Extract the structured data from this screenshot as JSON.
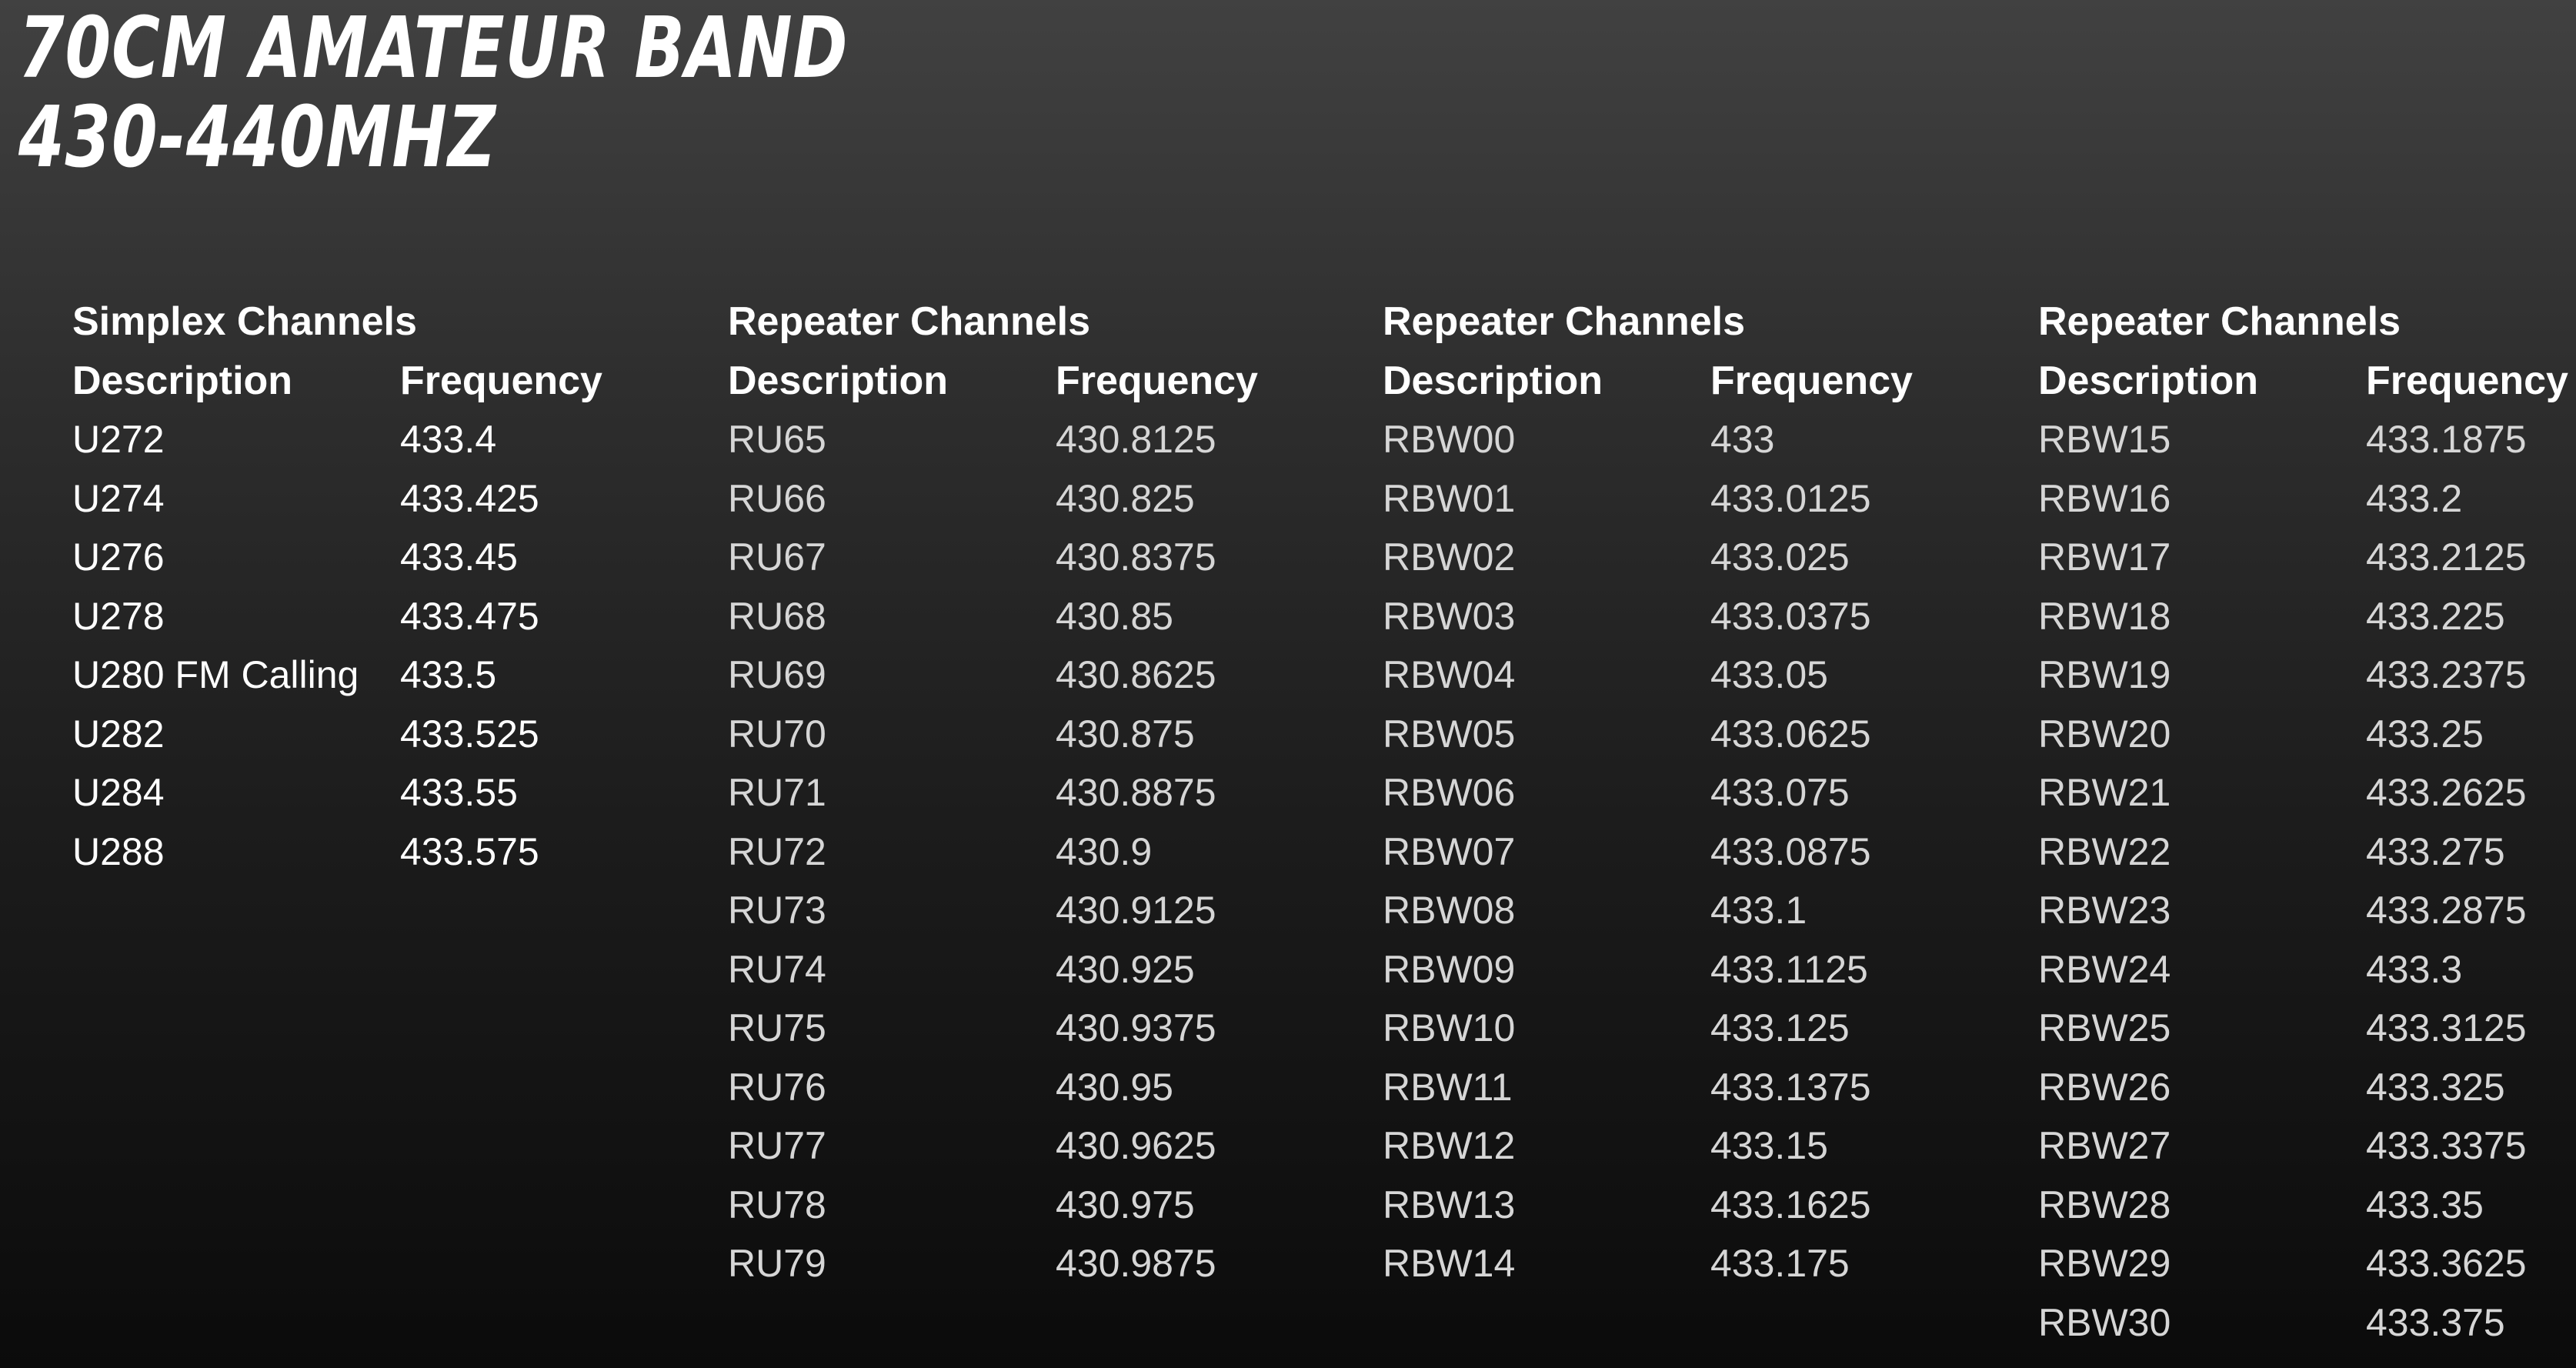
{
  "title": {
    "line1": "70CM AMATEUR BAND",
    "line2": "430-440MHZ"
  },
  "sections": [
    {
      "heading": "Simplex Channels",
      "col_description": "Description",
      "col_frequency": "Frequency",
      "rows": [
        {
          "description": "U272",
          "frequency": "433.4"
        },
        {
          "description": "U274",
          "frequency": "433.425"
        },
        {
          "description": "U276",
          "frequency": "433.45"
        },
        {
          "description": "U278",
          "frequency": "433.475"
        },
        {
          "description": "U280 FM Calling",
          "frequency": "433.5"
        },
        {
          "description": "U282",
          "frequency": "433.525"
        },
        {
          "description": "U284",
          "frequency": "433.55"
        },
        {
          "description": "U288",
          "frequency": "433.575"
        }
      ]
    },
    {
      "heading": "Repeater Channels",
      "col_description": "Description",
      "col_frequency": "Frequency",
      "rows": [
        {
          "description": "RU65",
          "frequency": "430.8125"
        },
        {
          "description": "RU66",
          "frequency": "430.825"
        },
        {
          "description": "RU67",
          "frequency": "430.8375"
        },
        {
          "description": "RU68",
          "frequency": "430.85"
        },
        {
          "description": "RU69",
          "frequency": "430.8625"
        },
        {
          "description": "RU70",
          "frequency": "430.875"
        },
        {
          "description": "RU71",
          "frequency": "430.8875"
        },
        {
          "description": "RU72",
          "frequency": "430.9"
        },
        {
          "description": "RU73",
          "frequency": "430.9125"
        },
        {
          "description": "RU74",
          "frequency": "430.925"
        },
        {
          "description": "RU75",
          "frequency": "430.9375"
        },
        {
          "description": "RU76",
          "frequency": "430.95"
        },
        {
          "description": "RU77",
          "frequency": "430.9625"
        },
        {
          "description": "RU78",
          "frequency": "430.975"
        },
        {
          "description": "RU79",
          "frequency": "430.9875"
        }
      ]
    },
    {
      "heading": "Repeater Channels",
      "col_description": "Description",
      "col_frequency": "Frequency",
      "rows": [
        {
          "description": "RBW00",
          "frequency": "433"
        },
        {
          "description": "RBW01",
          "frequency": "433.0125"
        },
        {
          "description": "RBW02",
          "frequency": "433.025"
        },
        {
          "description": "RBW03",
          "frequency": "433.0375"
        },
        {
          "description": "RBW04",
          "frequency": "433.05"
        },
        {
          "description": "RBW05",
          "frequency": "433.0625"
        },
        {
          "description": "RBW06",
          "frequency": "433.075"
        },
        {
          "description": "RBW07",
          "frequency": "433.0875"
        },
        {
          "description": "RBW08",
          "frequency": "433.1"
        },
        {
          "description": "RBW09",
          "frequency": "433.1125"
        },
        {
          "description": "RBW10",
          "frequency": "433.125"
        },
        {
          "description": "RBW11",
          "frequency": "433.1375"
        },
        {
          "description": "RBW12",
          "frequency": "433.15"
        },
        {
          "description": "RBW13",
          "frequency": "433.1625"
        },
        {
          "description": "RBW14",
          "frequency": "433.175"
        }
      ]
    },
    {
      "heading": "Repeater Channels",
      "col_description": "Description",
      "col_frequency": "Frequency",
      "rows": [
        {
          "description": "RBW15",
          "frequency": "433.1875"
        },
        {
          "description": "RBW16",
          "frequency": "433.2"
        },
        {
          "description": "RBW17",
          "frequency": "433.2125"
        },
        {
          "description": "RBW18",
          "frequency": "433.225"
        },
        {
          "description": "RBW19",
          "frequency": "433.2375"
        },
        {
          "description": "RBW20",
          "frequency": "433.25"
        },
        {
          "description": "RBW21",
          "frequency": "433.2625"
        },
        {
          "description": "RBW22",
          "frequency": "433.275"
        },
        {
          "description": "RBW23",
          "frequency": "433.2875"
        },
        {
          "description": "RBW24",
          "frequency": "433.3"
        },
        {
          "description": "RBW25",
          "frequency": "433.3125"
        },
        {
          "description": "RBW26",
          "frequency": "433.325"
        },
        {
          "description": "RBW27",
          "frequency": "433.3375"
        },
        {
          "description": "RBW28",
          "frequency": "433.35"
        },
        {
          "description": "RBW29",
          "frequency": "433.3625"
        },
        {
          "description": "RBW30",
          "frequency": "433.375"
        }
      ]
    }
  ]
}
